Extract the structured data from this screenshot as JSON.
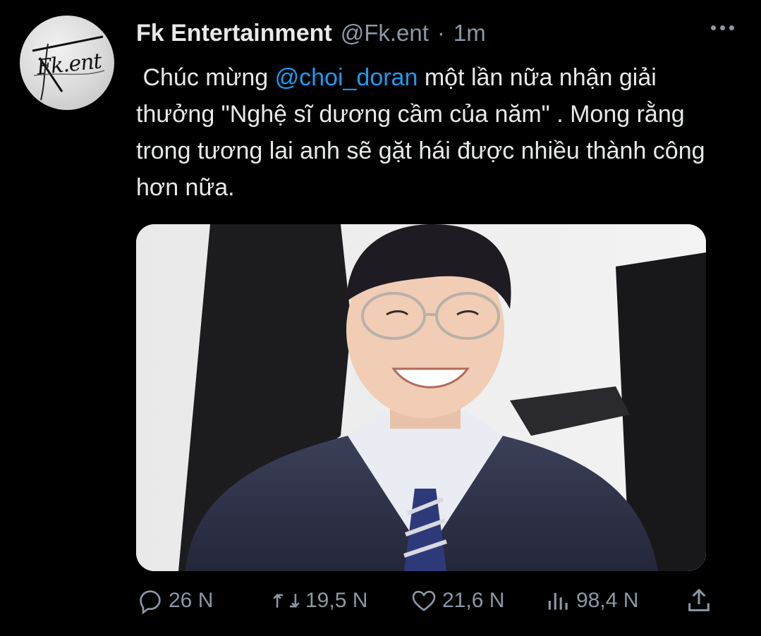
{
  "tweet": {
    "author_name": "Fk Entertainment",
    "handle": "@Fk.ent",
    "separator": "·",
    "time": "1m",
    "avatar_text": "Fk.ent",
    "text_before": " Chúc mừng ",
    "mention": "@choi_doran",
    "text_after": " một lần nữa nhận giải thưởng \"Nghệ sĩ dương cầm của năm\" . Mong rằng trong tương lai anh sẽ gặt hái được nhiều thành công hơn nữa."
  },
  "actions": {
    "reply_count": "26 N",
    "retweet_count": "19,5 N",
    "like_count": "21,6 N",
    "view_count": "98,4 N"
  },
  "icons": {
    "more": "more-icon",
    "reply": "reply-icon",
    "retweet": "retweet-icon",
    "like": "like-icon",
    "views": "views-icon",
    "share": "share-icon"
  },
  "colors": {
    "background": "#000000",
    "text": "#e7e9ea",
    "muted": "#8b98a5",
    "accent": "#1d9bf0"
  }
}
